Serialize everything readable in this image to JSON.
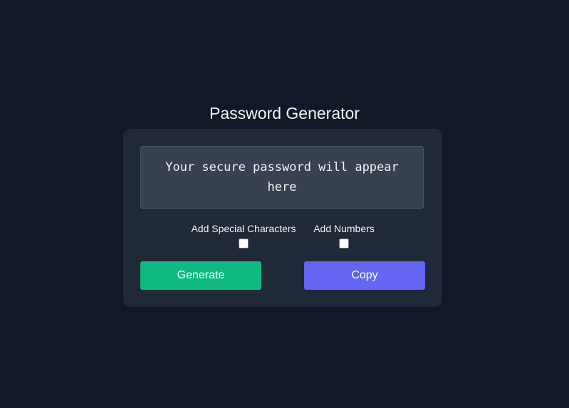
{
  "app": {
    "title": "Password Generator"
  },
  "output": {
    "text": "Your secure password will appear here"
  },
  "options": {
    "special_label": "Add Special Characters",
    "special_checked": false,
    "numbers_label": "Add Numbers",
    "numbers_checked": false
  },
  "actions": {
    "generate_label": "Generate",
    "copy_label": "Copy"
  },
  "colors": {
    "background": "#111827",
    "card": "#1f2937",
    "output_box": "#374151",
    "generate_button": "#10b981",
    "copy_button": "#6366f1"
  }
}
